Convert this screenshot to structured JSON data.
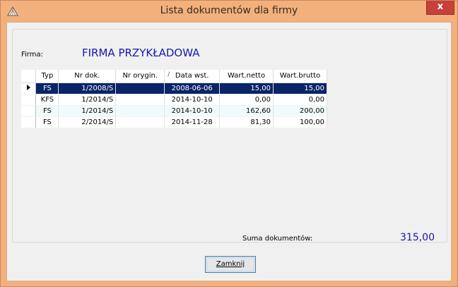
{
  "window": {
    "title": "Lista dokumentów dla firmy",
    "close_glyph": "x"
  },
  "firma": {
    "label": "Firma:",
    "value": "FIRMA PRZYKŁADOWA"
  },
  "table": {
    "columns": [
      "Typ",
      "Nr dok.",
      "Nr orygin.",
      "Data wst.",
      "Wart.netto",
      "Wart.brutto"
    ],
    "sorted_column_marker": "/",
    "rows": [
      {
        "typ": "FS",
        "nr_dok": "1/2008/S",
        "nr_orygin": "",
        "data": "2008-06-06",
        "netto": "15,00",
        "brutto": "15,00",
        "selected": true
      },
      {
        "typ": "KFS",
        "nr_dok": "1/2014/S",
        "nr_orygin": "",
        "data": "2014-10-10",
        "netto": "0,00",
        "brutto": "0,00",
        "selected": false
      },
      {
        "typ": "FS",
        "nr_dok": "1/2014/S",
        "nr_orygin": "",
        "data": "2014-10-10",
        "netto": "162,60",
        "brutto": "200,00",
        "selected": false
      },
      {
        "typ": "FS",
        "nr_dok": "2/2014/S",
        "nr_orygin": "",
        "data": "2014-11-28",
        "netto": "81,30",
        "brutto": "100,00",
        "selected": false
      }
    ]
  },
  "summary": {
    "label": "Suma dokumentów:",
    "value": "315,00"
  },
  "buttons": {
    "close_label": "Zamknij"
  },
  "colors": {
    "accent_text": "#1717b0",
    "selection": "#0a246a",
    "title_bar": "#f2b07c"
  }
}
